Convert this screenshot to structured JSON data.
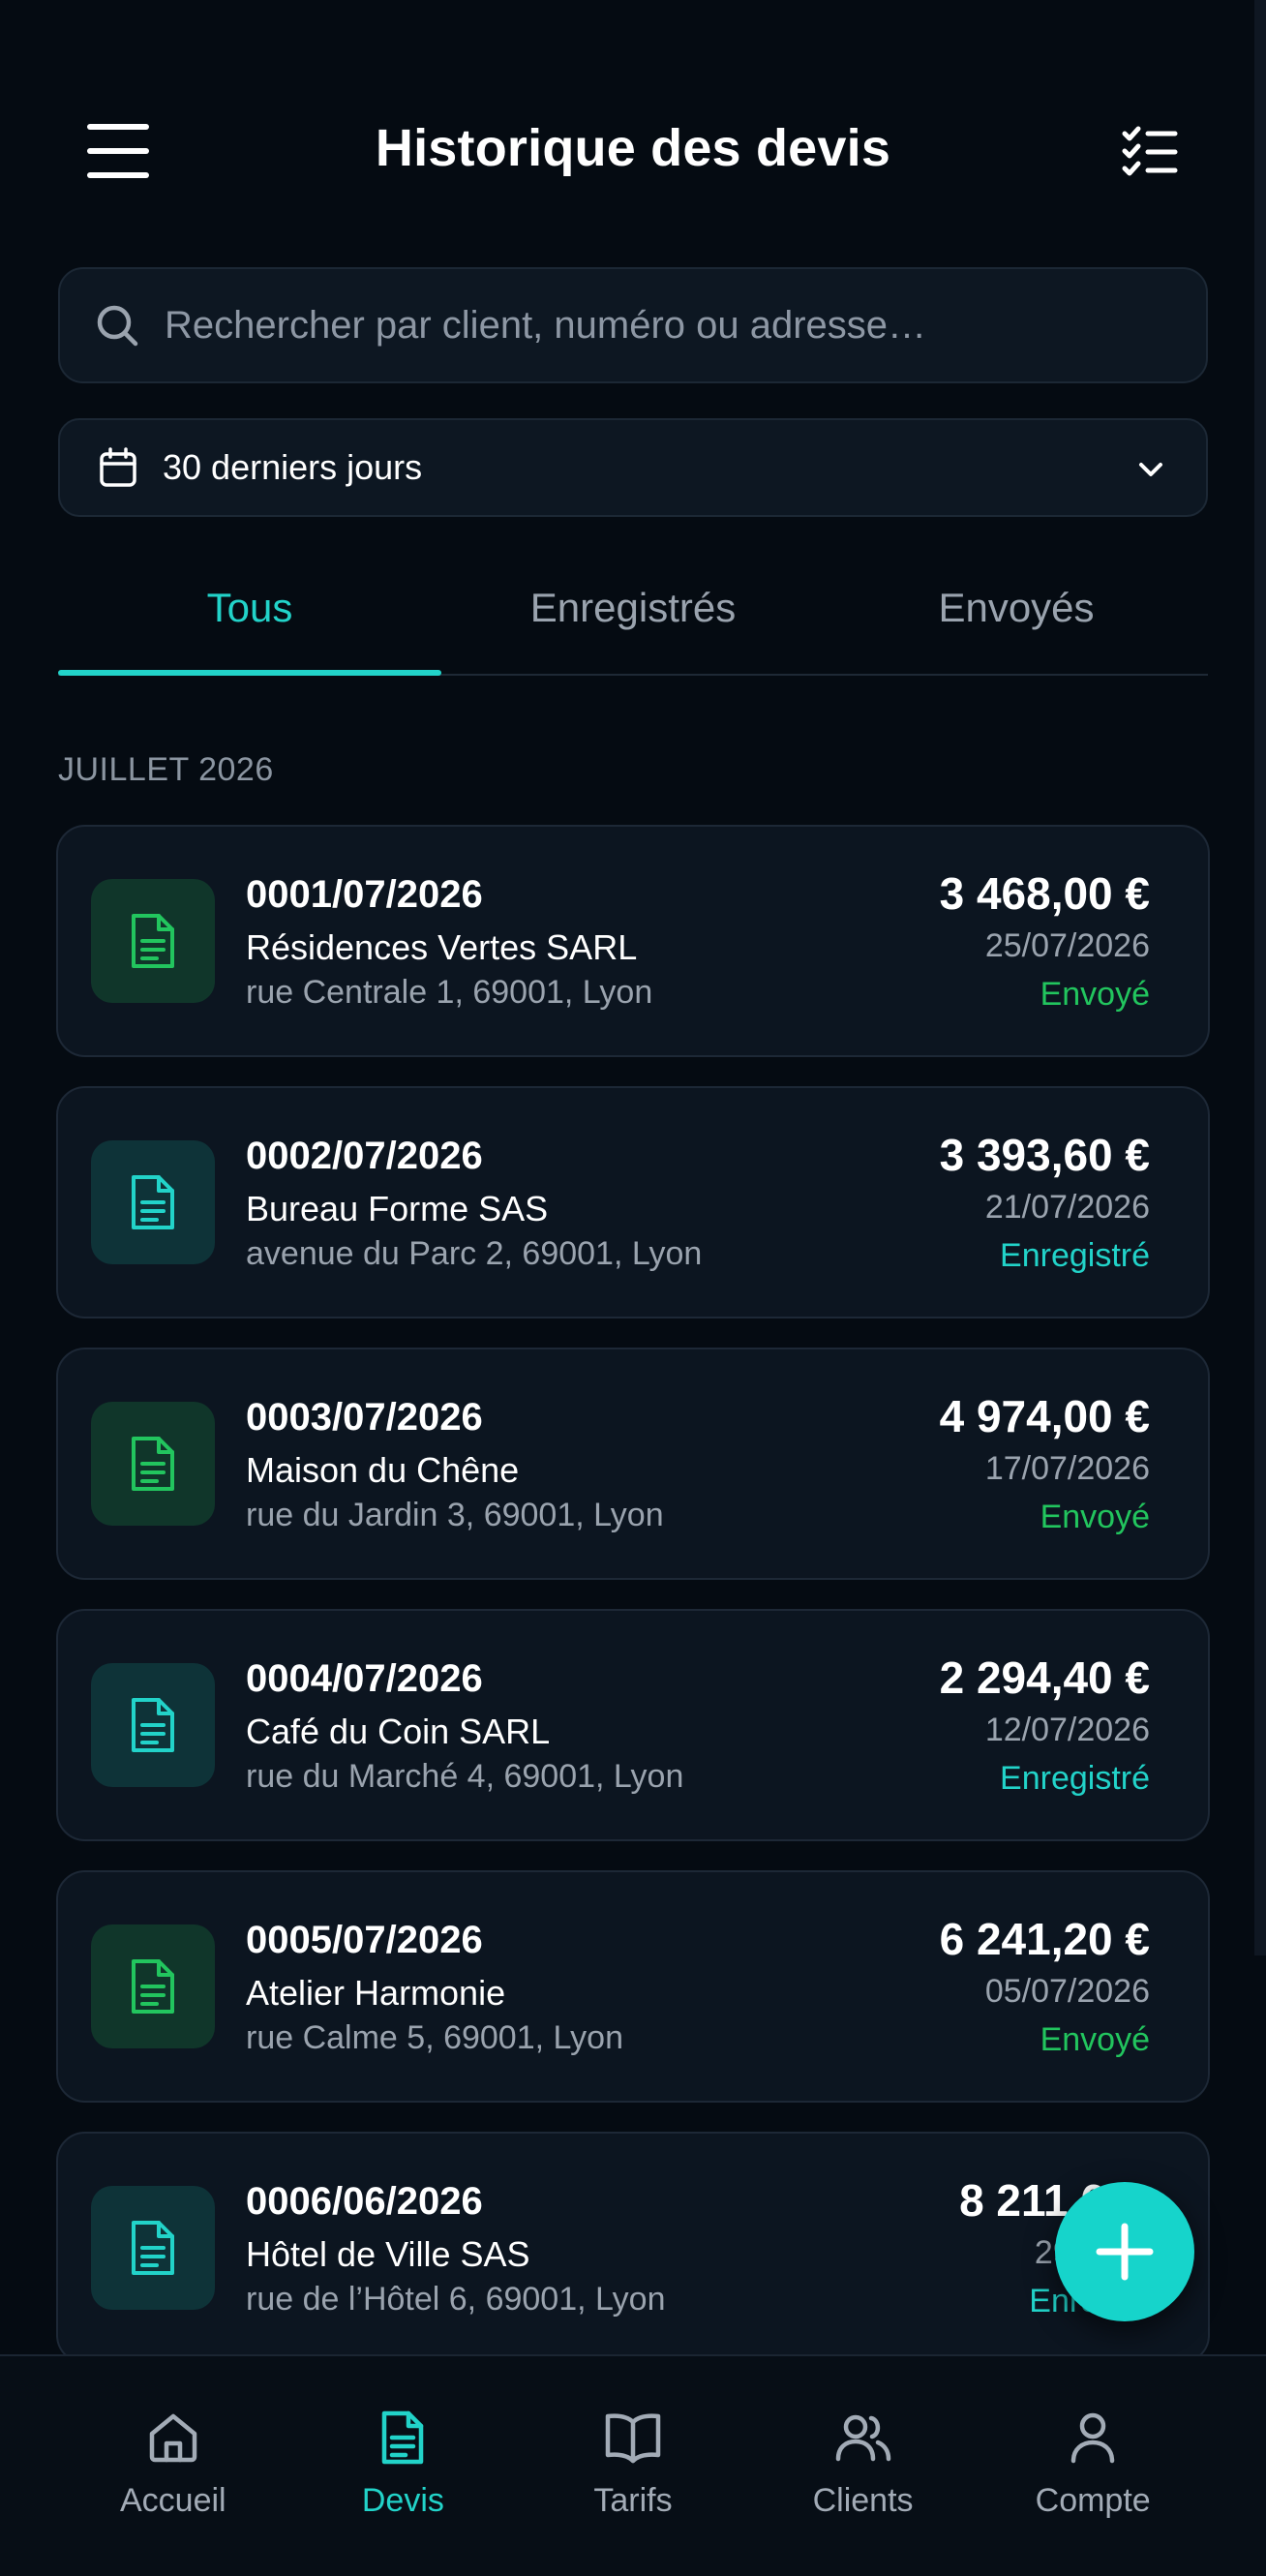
{
  "header": {
    "title": "Historique des devis",
    "menu_icon": "hamburger-menu-icon",
    "select_icon": "checklist-icon"
  },
  "search": {
    "placeholder": "Rechercher par client, numéro ou adresse…",
    "value": ""
  },
  "date_filter": {
    "selected": "30 derniers jours"
  },
  "tabs": [
    {
      "label": "Tous",
      "active": true
    },
    {
      "label": "Enregistrés",
      "active": false
    },
    {
      "label": "Envoyés",
      "active": false
    }
  ],
  "section_label": "JUILLET 2026",
  "quotes": [
    {
      "number": "0001/07/2026",
      "client": "Résidences Vertes SARL",
      "address": "rue Centrale 1, 69001, Lyon",
      "amount": "3 468,00 €",
      "date": "25/07/2026",
      "status": "Envoyé",
      "status_kind": "sent"
    },
    {
      "number": "0002/07/2026",
      "client": "Bureau Forme SAS",
      "address": "avenue du Parc 2, 69001, Lyon",
      "amount": "3 393,60 €",
      "date": "21/07/2026",
      "status": "Enregistré",
      "status_kind": "saved"
    },
    {
      "number": "0003/07/2026",
      "client": "Maison du Chêne",
      "address": "rue du Jardin 3, 69001, Lyon",
      "amount": "4 974,00 €",
      "date": "17/07/2026",
      "status": "Envoyé",
      "status_kind": "sent"
    },
    {
      "number": "0004/07/2026",
      "client": "Café du Coin SARL",
      "address": "rue du Marché 4, 69001, Lyon",
      "amount": "2 294,40 €",
      "date": "12/07/2026",
      "status": "Enregistré",
      "status_kind": "saved"
    },
    {
      "number": "0005/07/2026",
      "client": "Atelier Harmonie",
      "address": "rue Calme 5, 69001, Lyon",
      "amount": "6 241,20 €",
      "date": "05/07/2026",
      "status": "Envoyé",
      "status_kind": "sent"
    },
    {
      "number": "0006/06/2026",
      "client": "Hôtel de Ville SAS",
      "address": "rue de l’Hôtel 6, 69001, Lyon",
      "amount": "8 211,6…",
      "date": "29/06…",
      "status": "Enreg…",
      "status_kind": "saved"
    }
  ],
  "nav": [
    {
      "label": "Accueil",
      "icon": "home-icon",
      "active": false
    },
    {
      "label": "Devis",
      "icon": "document-icon",
      "active": true
    },
    {
      "label": "Tarifs",
      "icon": "book-icon",
      "active": false
    },
    {
      "label": "Clients",
      "icon": "users-icon",
      "active": false
    },
    {
      "label": "Compte",
      "icon": "user-icon",
      "active": false
    }
  ],
  "colors": {
    "accent": "#22d3c9",
    "sent": "#22c55e",
    "background": "#050b12",
    "card": "#0c1520"
  }
}
